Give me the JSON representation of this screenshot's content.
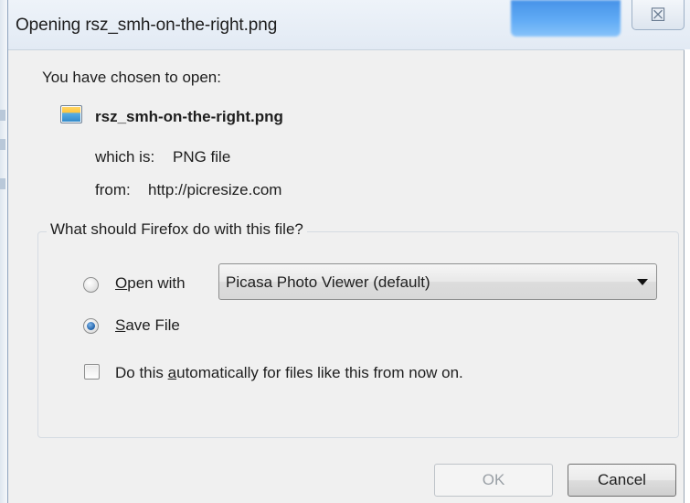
{
  "window": {
    "title": "Opening rsz_smh-on-the-right.png",
    "close_glyph": "☒"
  },
  "dialog": {
    "chosen_label": "You have chosen to open:",
    "file": {
      "icon": "png-image-file-icon",
      "name": "rsz_smh-on-the-right.png",
      "which_is_label": "which is:",
      "type": "PNG file",
      "from_label": "from:",
      "source": "http://picresize.com"
    },
    "action_group": {
      "legend": "What should Firefox do with this file?",
      "open_with": {
        "mnemonic": "O",
        "rest": "pen with",
        "checked": false,
        "selected_app": "Picasa Photo Viewer (default)"
      },
      "save_file": {
        "mnemonic": "S",
        "rest": "ave File",
        "checked": true
      },
      "auto": {
        "before": "Do this ",
        "mnemonic": "a",
        "after": "utomatically for files like this from now on.",
        "checked": false
      }
    },
    "buttons": {
      "ok": "OK",
      "ok_enabled": false,
      "cancel": "Cancel"
    }
  },
  "colors": {
    "title_bar": "#e2eaf4",
    "client_bg": "#f0f0f0",
    "highlight_glow": "#5aa8f5"
  }
}
